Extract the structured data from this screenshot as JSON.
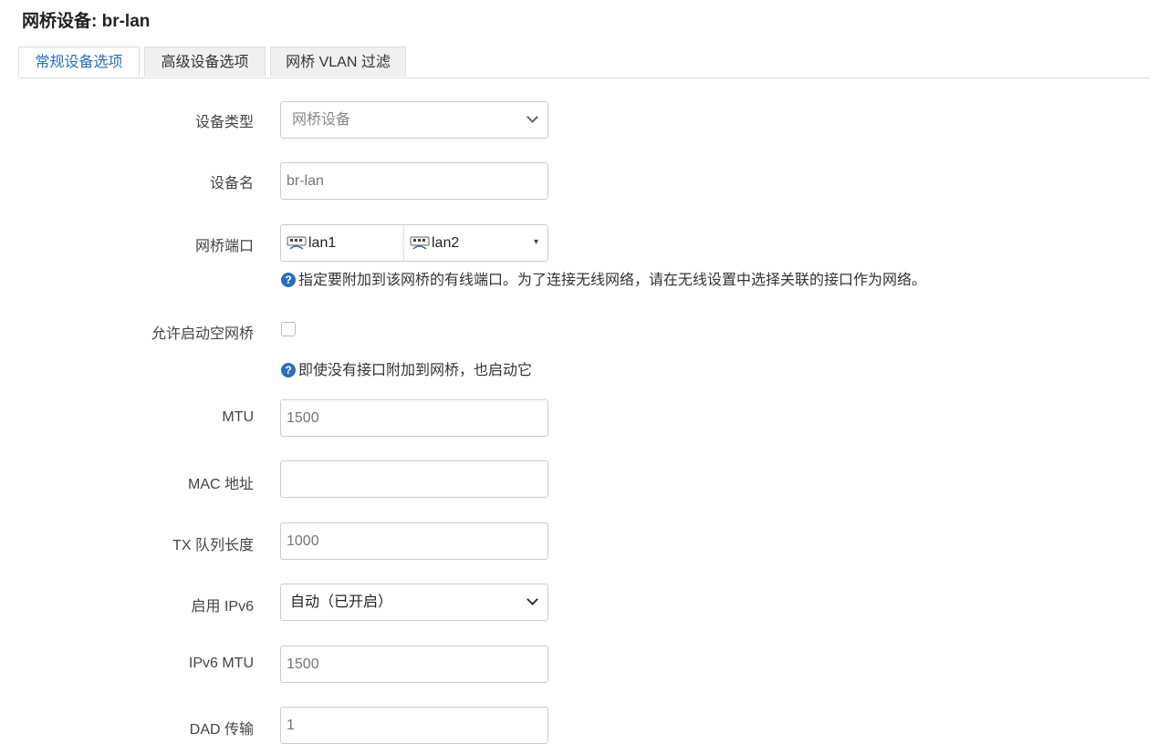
{
  "title": "网桥设备: br-lan",
  "tabs": [
    {
      "label": "常规设备选项",
      "active": true
    },
    {
      "label": "高级设备选项",
      "active": false
    },
    {
      "label": "网桥 VLAN 过滤",
      "active": false
    }
  ],
  "form": {
    "device_type": {
      "label": "设备类型",
      "value": "网桥设备"
    },
    "device_name": {
      "label": "设备名",
      "value": "br-lan"
    },
    "bridge_ports": {
      "label": "网桥端口",
      "ports": [
        "lan1",
        "lan2"
      ],
      "hint": "指定要附加到该网桥的有线端口。为了连接无线网络，请在无线设置中选择关联的接口作为网络。"
    },
    "bring_up_empty": {
      "label": "允许启动空网桥",
      "checked": false,
      "hint": "即使没有接口附加到网桥，也启动它"
    },
    "mtu": {
      "label": "MTU",
      "placeholder": "1500"
    },
    "mac": {
      "label": "MAC 地址",
      "value": ""
    },
    "txqueuelen": {
      "label": "TX 队列长度",
      "placeholder": "1000"
    },
    "ipv6": {
      "label": "启用 IPv6",
      "value": "自动（已开启）"
    },
    "ipv6_mtu": {
      "label": "IPv6 MTU",
      "placeholder": "1500"
    },
    "dad_transmits": {
      "label": "DAD 传输",
      "placeholder": "1"
    }
  },
  "colors": {
    "accent": "#2a6ebb",
    "border": "#cccccc"
  }
}
